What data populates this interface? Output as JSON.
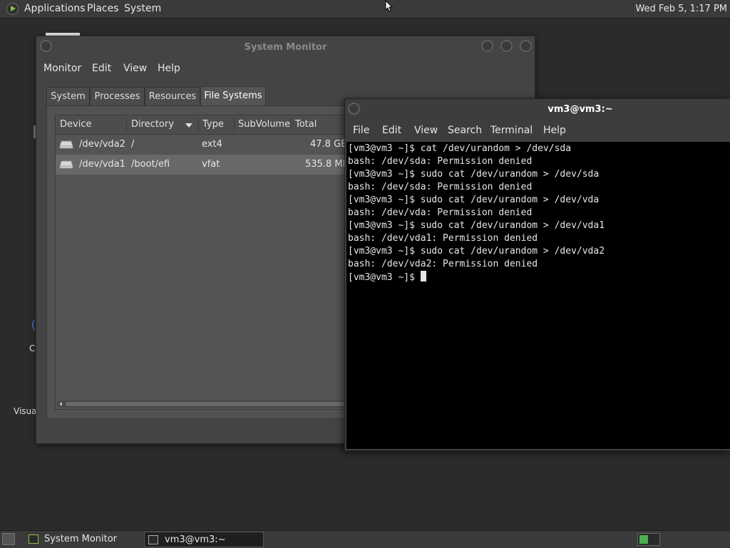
{
  "top_panel": {
    "menus": [
      "Applications",
      "Places",
      "System"
    ],
    "clock": "Wed Feb  5, 1:17 PM"
  },
  "desktop": {
    "labels": [
      "C",
      "Visua"
    ]
  },
  "system_monitor": {
    "title": "System Monitor",
    "menu": [
      "Monitor",
      "Edit",
      "View",
      "Help"
    ],
    "tabs": [
      "System",
      "Processes",
      "Resources",
      "File Systems"
    ],
    "active_tab": "File Systems",
    "columns": [
      "Device",
      "Directory",
      "Type",
      "SubVolume",
      "Total"
    ],
    "rows": [
      {
        "device": "/dev/vda2",
        "directory": "/",
        "type": "ext4",
        "subvolume": "",
        "total": "47.8 GB"
      },
      {
        "device": "/dev/vda1",
        "directory": "/boot/efi",
        "type": "vfat",
        "subvolume": "",
        "total": "535.8 MB"
      }
    ]
  },
  "terminal": {
    "title": "vm3@vm3:~",
    "menu": [
      "File",
      "Edit",
      "View",
      "Search",
      "Terminal",
      "Help"
    ],
    "lines": [
      "[vm3@vm3 ~]$ cat /dev/urandom > /dev/sda",
      "bash: /dev/sda: Permission denied",
      "[vm3@vm3 ~]$ sudo cat /dev/urandom > /dev/sda",
      "bash: /dev/sda: Permission denied",
      "[vm3@vm3 ~]$ sudo cat /dev/urandom > /dev/vda",
      "bash: /dev/vda: Permission denied",
      "[vm3@vm3 ~]$ sudo cat /dev/urandom > /dev/vda1",
      "bash: /dev/vda1: Permission denied",
      "[vm3@vm3 ~]$ sudo cat /dev/urandom > /dev/vda2",
      "bash: /dev/vda2: Permission denied"
    ],
    "prompt": "[vm3@vm3 ~]$ "
  },
  "taskbar": {
    "items": [
      {
        "label": "System Monitor",
        "active": false
      },
      {
        "label": "vm3@vm3:~",
        "active": true
      }
    ]
  }
}
